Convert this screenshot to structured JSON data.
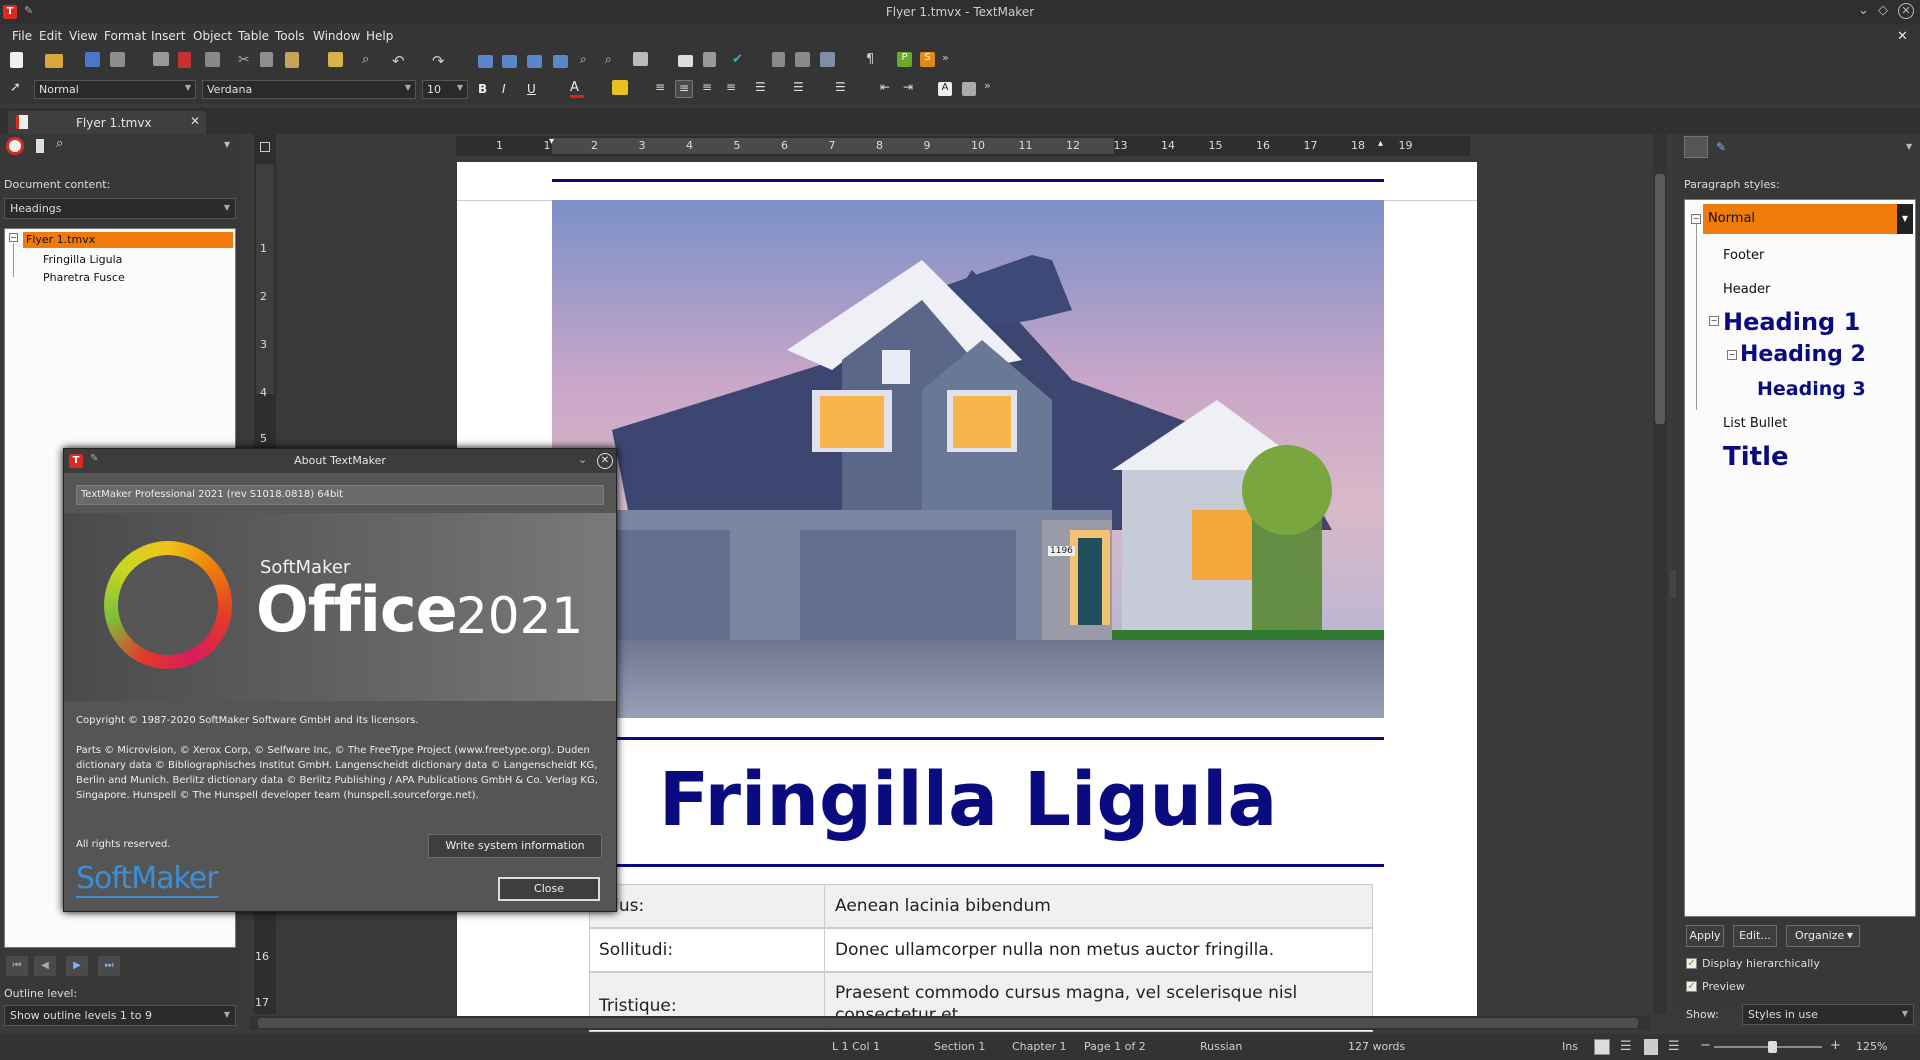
{
  "window": {
    "title": "Flyer 1.tmvx - TextMaker"
  },
  "menu": [
    "File",
    "Edit",
    "View",
    "Format",
    "Insert",
    "Object",
    "Table",
    "Tools",
    "Window",
    "Help"
  ],
  "format_bar": {
    "style": "Normal",
    "font": "Verdana",
    "size": "10"
  },
  "tab": {
    "label": "Flyer 1.tmvx"
  },
  "left_panel": {
    "doc_content_label": "Document content:",
    "doc_content_value": "Headings",
    "tree": [
      "Flyer 1.tmvx",
      "Fringilla Ligula",
      "Pharetra Fusce"
    ],
    "outline_label": "Outline level:",
    "outline_value": "Show outline levels 1 to 9"
  },
  "ruler": {
    "h_ticks": [
      "1",
      "1",
      "2",
      "3",
      "4",
      "5",
      "6",
      "7",
      "8",
      "9",
      "10",
      "11",
      "12",
      "13",
      "14",
      "15",
      "16",
      "17",
      "18",
      "19"
    ],
    "v_ticks": [
      "1",
      "2",
      "3",
      "4",
      "5",
      "16",
      "17"
    ]
  },
  "document": {
    "heading": "Fringilla Ligula",
    "table": [
      [
        "ellus:",
        "Aenean lacinia bibendum"
      ],
      [
        "Sollitudi:",
        "Donec ullamcorper nulla non metus auctor fringilla."
      ],
      [
        "Tristique:",
        "Praesent commodo cursus magna, vel scelerisque nisl consectetur et."
      ]
    ],
    "house_number": "1196"
  },
  "right_panel": {
    "label": "Paragraph styles:",
    "styles": [
      "Normal",
      "Footer",
      "Header",
      "Heading 1",
      "Heading 2",
      "Heading 3",
      "List Bullet",
      "Title"
    ],
    "buttons": {
      "apply": "Apply",
      "edit": "Edit...",
      "organize": "Organize"
    },
    "check_hier": "Display hierarchically",
    "check_preview": "Preview",
    "show_label": "Show:",
    "show_value": "Styles in use"
  },
  "dialog": {
    "title": "About TextMaker",
    "version": "TextMaker Professional 2021 (rev S1018.0818) 64bit",
    "brand_top": "SoftMaker",
    "brand_office": "Office",
    "brand_year": "2021",
    "copyright": "Copyright © 1987-2020 SoftMaker Software GmbH and its licensors.",
    "parts": "Parts © Microvision, © Xerox Corp, © Selfware Inc, © The FreeType Project (www.freetype.org). Duden dictionary data © Bibliographisches Institut GmbH. Langenscheidt dictionary data © Langenscheidt KG, Berlin and Munich. Berlitz dictionary data © Berlitz Publishing / APA Publications GmbH & Co. Verlag KG, Singapore. Hunspell © The Hunspell developer team (hunspell.sourceforge.net).",
    "rights": "All rights reserved.",
    "write_btn": "Write system information",
    "close_btn": "Close",
    "logo": "SoftMaker"
  },
  "status": {
    "pos": "L 1 Col 1",
    "section": "Section 1",
    "chapter": "Chapter 1",
    "page": "Page 1 of 2",
    "lang": "Russian",
    "words": "127 words",
    "mode": "Ins",
    "zoom": "125%"
  },
  "colors": {
    "accent": "#ee7b0a",
    "heading": "#0b0b80",
    "dark": "#353535"
  }
}
